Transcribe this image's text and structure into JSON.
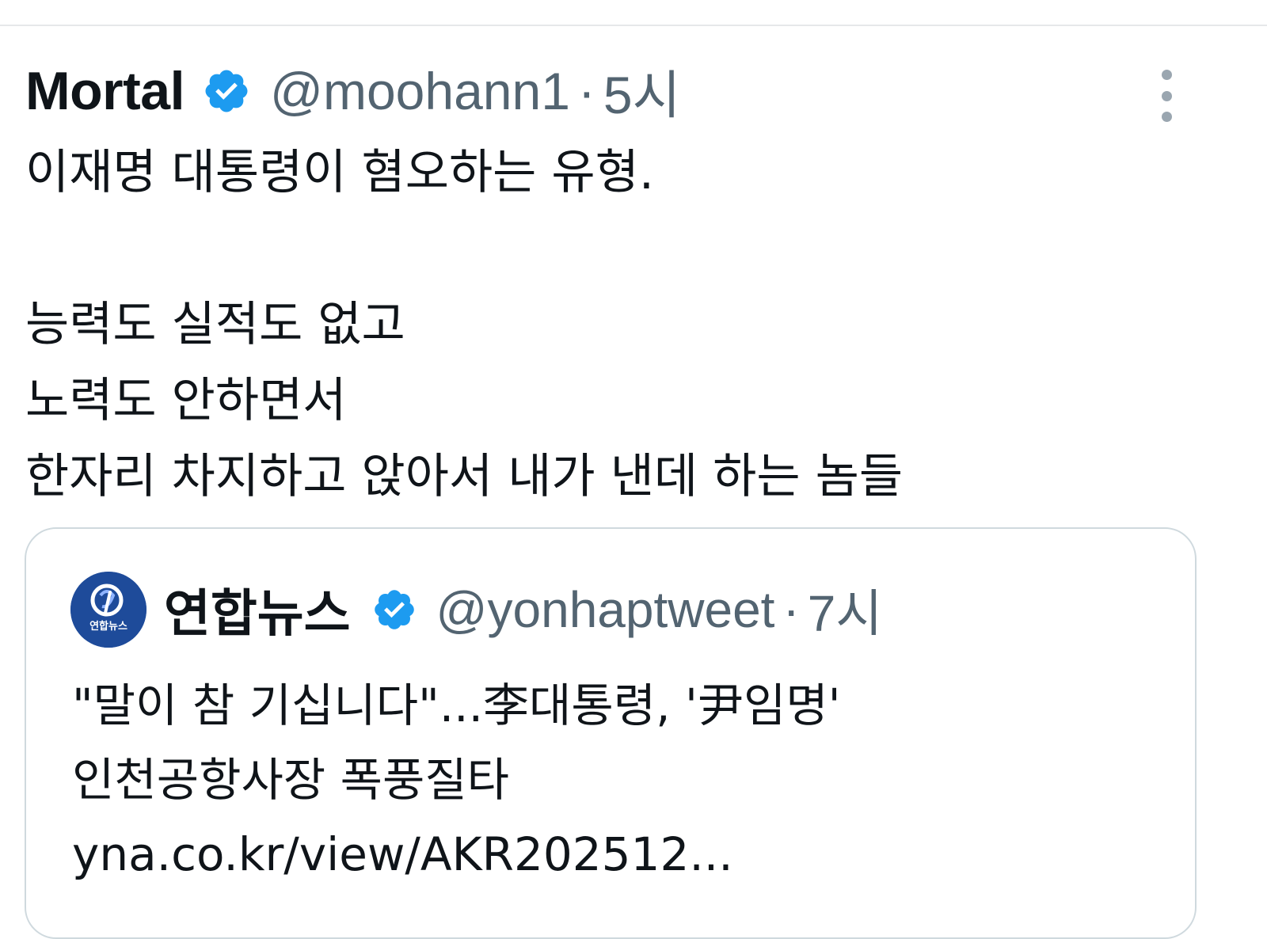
{
  "tweet": {
    "author_name": "Mortal",
    "handle": "@moohann1",
    "separator": "·",
    "time": "5시",
    "text_lines": [
      "이재명 대통령이 혐오하는 유형.",
      "",
      "능력도 실적도 없고",
      "노력도 안하면서",
      "한자리 차지하고 앉아서 내가 낸데 하는 놈들"
    ]
  },
  "quote": {
    "author_name": "연합뉴스",
    "avatar_label": "연합뉴스",
    "handle": "@yonhaptweet",
    "separator": "·",
    "time": "7시",
    "text_lines": [
      "\"말이 참 기십니다\"...李대통령, '尹임명'",
      "인천공항사장 폭풍질타",
      "yna.co.kr/view/AKR202512..."
    ]
  },
  "colors": {
    "verified_blue": "#1d9bf0",
    "secondary_text": "#536471",
    "primary_text": "#0f1419",
    "border": "#cfd9de"
  },
  "icons": {
    "verified": "verified-badge-icon",
    "more": "more-options-icon",
    "avatar": "yonhap-logo"
  }
}
